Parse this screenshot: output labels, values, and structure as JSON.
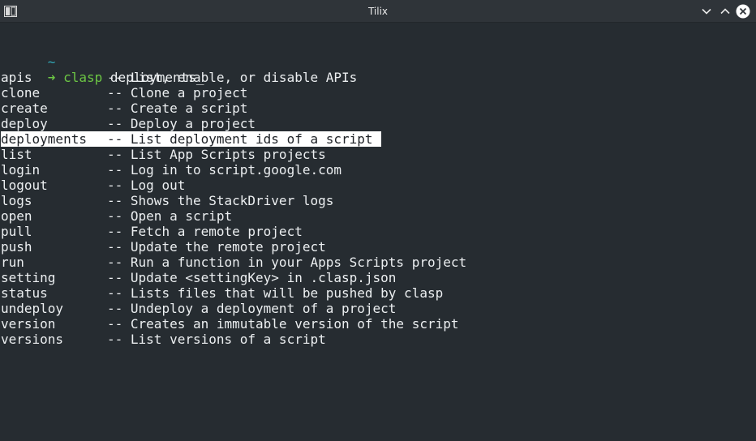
{
  "window": {
    "title": "Tilix",
    "icons": {
      "app": "terminal-app-icon",
      "minimize": "chevron-down-icon",
      "maximize": "chevron-up-icon",
      "close": "close-icon"
    },
    "colors": {
      "background": "#262c31",
      "titlebar": "#2f3439",
      "prompt_green": "#6cc644",
      "tilde_cyan": "#32a8b7",
      "text": "#eceff1",
      "selection_bg": "#ffffff",
      "selection_fg": "#1d2126"
    }
  },
  "terminal": {
    "cwd": "~",
    "prompt_arrow": "➜",
    "command": "clasp",
    "argument": "deployments",
    "cursor": "_",
    "separator": "--",
    "completions": [
      {
        "name": "apis",
        "description": "List, enable, or disable APIs"
      },
      {
        "name": "clone",
        "description": "Clone a project"
      },
      {
        "name": "create",
        "description": "Create a script"
      },
      {
        "name": "deploy",
        "description": "Deploy a project"
      },
      {
        "name": "deployments",
        "description": "List deployment ids of a script",
        "selected": true
      },
      {
        "name": "list",
        "description": "List App Scripts projects"
      },
      {
        "name": "login",
        "description": "Log in to script.google.com"
      },
      {
        "name": "logout",
        "description": "Log out"
      },
      {
        "name": "logs",
        "description": "Shows the StackDriver logs"
      },
      {
        "name": "open",
        "description": "Open a script"
      },
      {
        "name": "pull",
        "description": "Fetch a remote project"
      },
      {
        "name": "push",
        "description": "Update the remote project"
      },
      {
        "name": "run",
        "description": "Run a function in your Apps Scripts project"
      },
      {
        "name": "setting",
        "description": "Update <settingKey> in .clasp.json"
      },
      {
        "name": "status",
        "description": "Lists files that will be pushed by clasp"
      },
      {
        "name": "undeploy",
        "description": "Undeploy a deployment of a project"
      },
      {
        "name": "version",
        "description": "Creates an immutable version of the script"
      },
      {
        "name": "versions",
        "description": "List versions of a script"
      }
    ]
  }
}
